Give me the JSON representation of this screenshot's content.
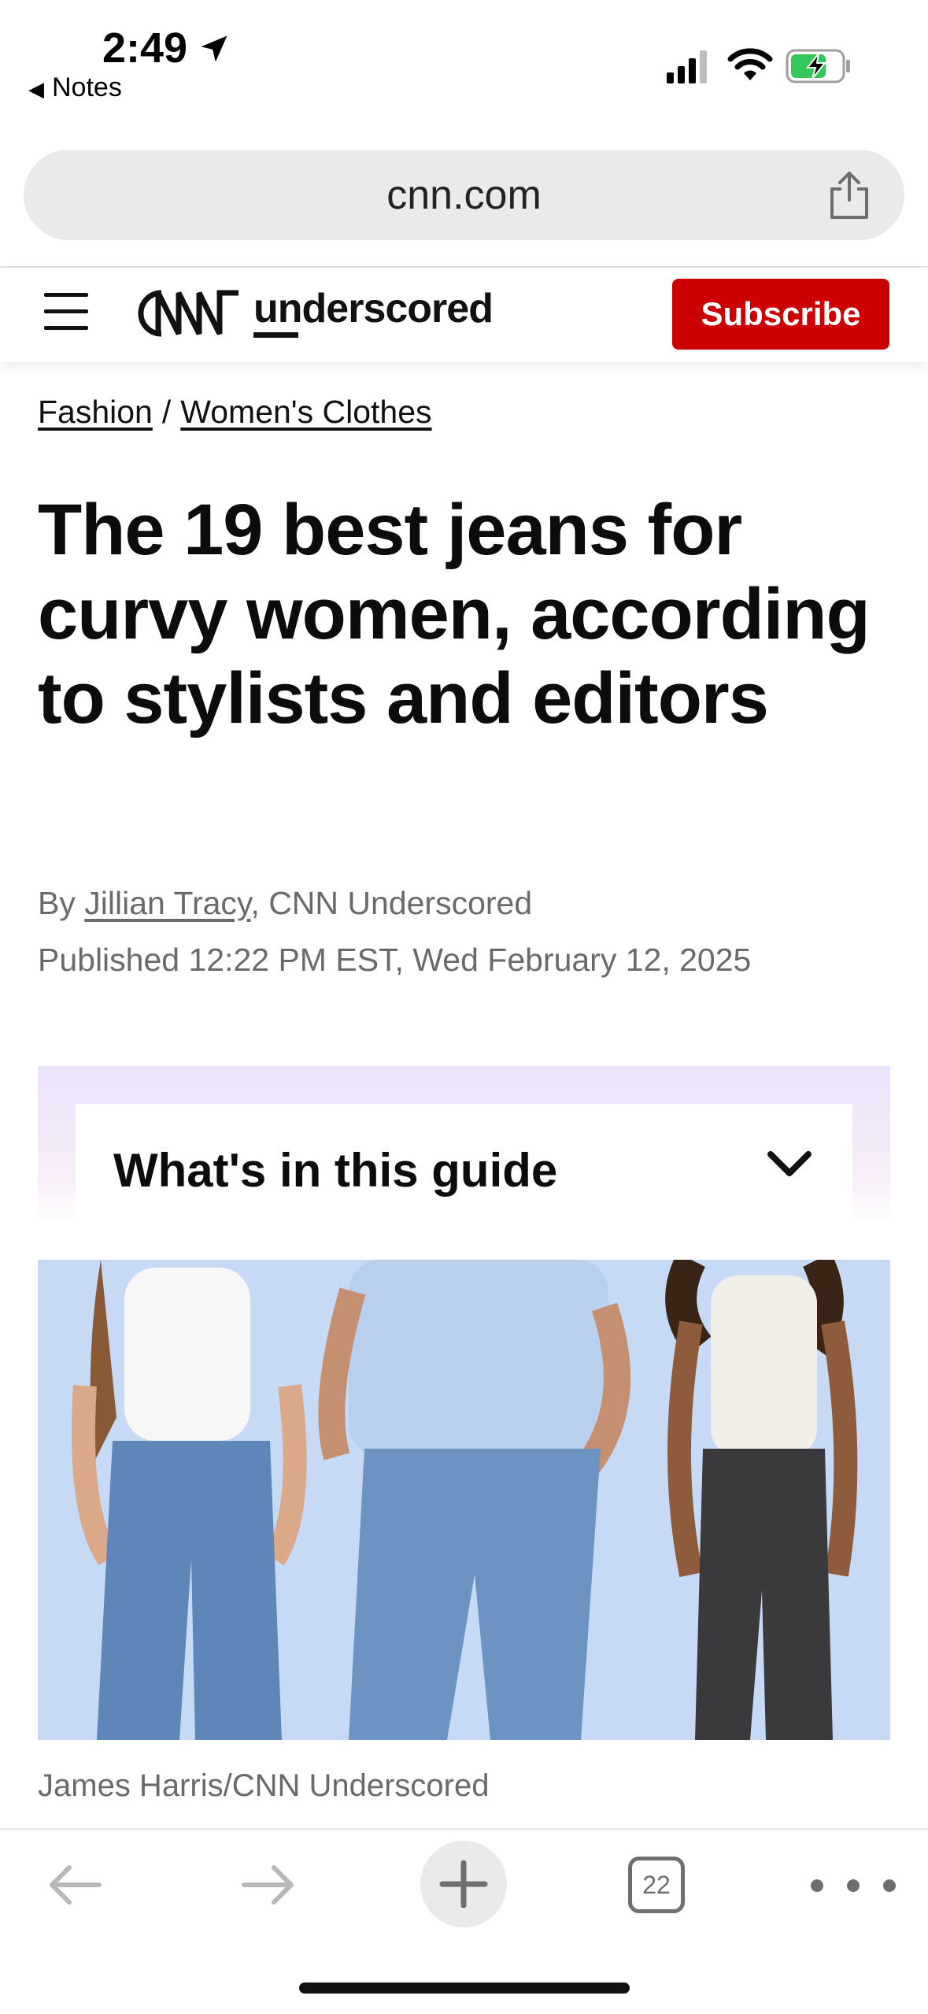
{
  "status_bar": {
    "time": "2:49",
    "back_app": "Notes",
    "battery_state": "charging",
    "accent_battery": "#34c759"
  },
  "browser": {
    "url": "cnn.com",
    "tab_count": "22"
  },
  "site_header": {
    "logo_text": "CNN",
    "brand": "underscored",
    "subscribe_label": "Subscribe",
    "subscribe_color": "#cc0000"
  },
  "article": {
    "breadcrumb": [
      "Fashion",
      "Women's Clothes"
    ],
    "breadcrumb_separator": "/",
    "title": "The 19 best jeans for curvy women, according to stylists and editors",
    "byline_prefix": "By",
    "author": "Jillian Tracy",
    "byline_suffix": ", CNN Underscored",
    "published": "Published 12:22 PM EST, Wed February 12, 2025",
    "guide_label": "What's in this guide",
    "image_caption": "James Harris/CNN Underscored"
  },
  "icons": {
    "hamburger": "menu-icon",
    "share": "share-icon",
    "chevron": "chevron-down-icon",
    "back": "arrow-left-icon",
    "forward": "arrow-right-icon",
    "new_tab": "plus-icon",
    "tabs": "tabs-icon",
    "more": "more-icon"
  }
}
